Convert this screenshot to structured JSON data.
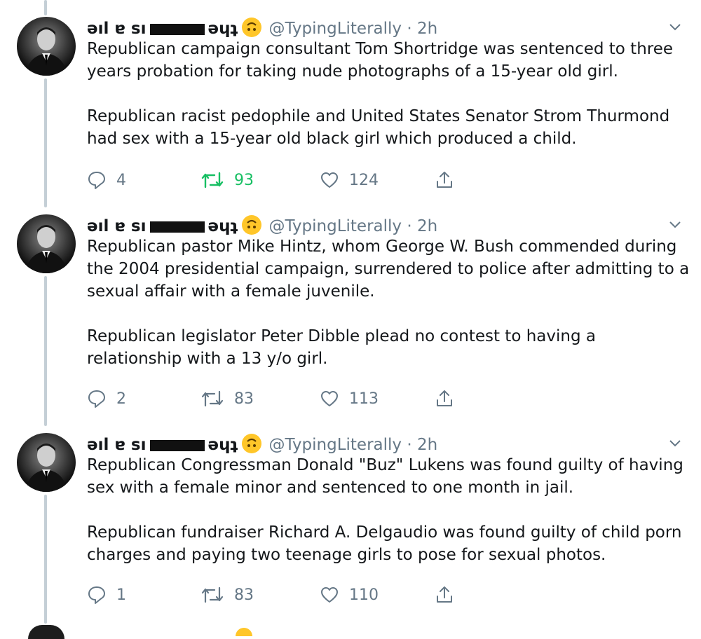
{
  "tweets": [
    {
      "name_part1": "ǝıl ɐ sı",
      "name_part2": "ǝɥʇ",
      "handle": "@TypingLiterally",
      "separator": "·",
      "time": "2h",
      "paragraphs": [
        "Republican campaign consultant Tom Shortridge was sentenced to three years probation for taking nude photographs of a 15-year old girl.",
        "Republican racist pedophile and United States Senator Strom Thurmond had sex with a 15-year old black girl which produced a child."
      ],
      "replies": "4",
      "retweets": "93",
      "likes": "124",
      "retweeted": true
    },
    {
      "name_part1": "ǝıl ɐ sı",
      "name_part2": "ǝɥʇ",
      "handle": "@TypingLiterally",
      "separator": "·",
      "time": "2h",
      "paragraphs": [
        "Republican pastor Mike Hintz, whom George W. Bush commended during the 2004 presidential campaign, surrendered to police after admitting to a sexual affair with a female juvenile.",
        "Republican legislator Peter Dibble plead no contest to having a relationship with a 13 y/o girl."
      ],
      "replies": "2",
      "retweets": "83",
      "likes": "113",
      "retweeted": false
    },
    {
      "name_part1": "ǝıl ɐ sı",
      "name_part2": "ǝɥʇ",
      "handle": "@TypingLiterally",
      "separator": "·",
      "time": "2h",
      "paragraphs": [
        "Republican Congressman Donald \"Buz\" Lukens was found guilty of having sex with a female minor and sentenced to one month in jail.",
        "Republican fundraiser Richard A. Delgaudio was found guilty of child porn charges and paying two teenage girls to pose for sexual photos."
      ],
      "replies": "1",
      "retweets": "83",
      "likes": "110",
      "retweeted": false
    }
  ],
  "icons": {
    "reply": "reply-icon",
    "retweet": "retweet-icon",
    "like": "like-icon",
    "share": "share-icon",
    "caret": "chevron-down-icon",
    "emoji": "upside-down-face-emoji"
  },
  "colors": {
    "text": "#14171a",
    "muted": "#657786",
    "retweet_active": "#17bf63",
    "thread_line": "#c4cfd6",
    "emoji": "#ffc629"
  }
}
